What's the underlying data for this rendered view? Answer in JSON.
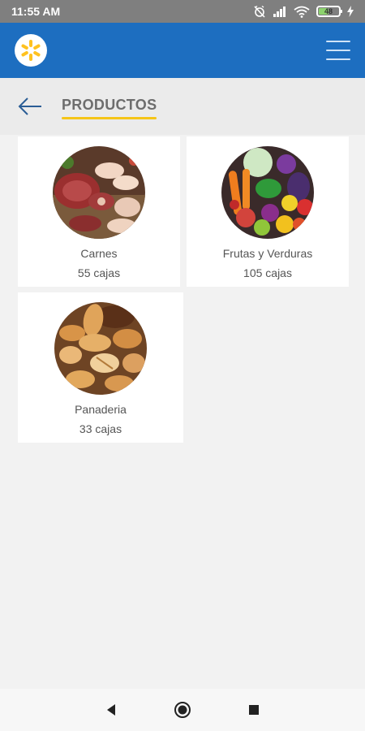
{
  "status_bar": {
    "time": "11:55 AM",
    "battery_level": "48",
    "icons": [
      "alarm-off-icon",
      "signal-icon",
      "wifi-icon",
      "battery-icon",
      "charging-icon"
    ]
  },
  "header": {
    "logo_icon": "walmart-spark-icon",
    "menu_icon": "hamburger-menu-icon",
    "brand_color": "#1d6ec0",
    "spark_color": "#ffc220"
  },
  "subheader": {
    "back_icon": "arrow-left-icon",
    "title": "PRODUCTOS",
    "underline_color": "#f5c518"
  },
  "products": [
    {
      "name": "Carnes",
      "count": "55 cajas",
      "image": "meat-photo"
    },
    {
      "name": "Frutas y Verduras",
      "count": "105 cajas",
      "image": "vegetables-photo"
    },
    {
      "name": "Panaderia",
      "count": "33 cajas",
      "image": "bread-photo"
    }
  ],
  "nav_bar": {
    "icons": [
      "back-triangle-icon",
      "home-circle-icon",
      "recents-square-icon"
    ]
  }
}
